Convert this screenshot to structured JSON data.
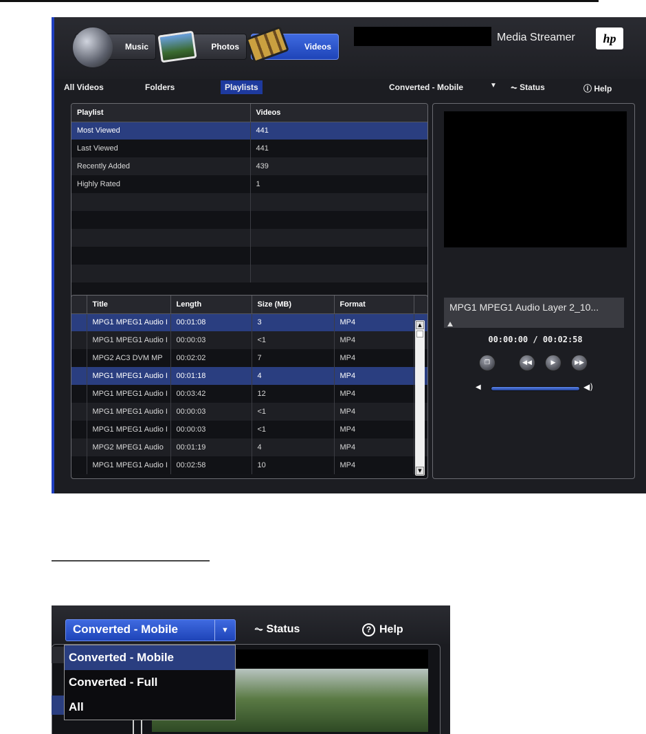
{
  "app": {
    "tabs": [
      {
        "label": "Music",
        "active": false
      },
      {
        "label": "Photos",
        "active": false
      },
      {
        "label": "Videos",
        "active": true
      }
    ],
    "brand": "Media Streamer",
    "logo": "hp"
  },
  "nav": {
    "items": [
      "All Videos",
      "Folders",
      "Playlists"
    ],
    "active": "Playlists",
    "filter": "Converted - Mobile",
    "status": "Status",
    "help": "Help"
  },
  "playlists": {
    "headers": [
      "Playlist",
      "Videos"
    ],
    "rows": [
      {
        "name": "Most Viewed",
        "videos": "441",
        "selected": true
      },
      {
        "name": "Last Viewed",
        "videos": "441"
      },
      {
        "name": "Recently Added",
        "videos": "439"
      },
      {
        "name": "Highly Rated",
        "videos": "1"
      }
    ]
  },
  "videos": {
    "headers": [
      "Title",
      "Length",
      "Size (MB)",
      "Format"
    ],
    "rows": [
      {
        "title": "MPG1 MPEG1 Audio I",
        "length": "00:01:08",
        "size": "3",
        "format": "MP4",
        "selected": true
      },
      {
        "title": "MPG1 MPEG1 Audio I",
        "length": "00:00:03",
        "size": "<1",
        "format": "MP4"
      },
      {
        "title": "MPG2 AC3 DVM MP",
        "length": "00:02:02",
        "size": "7",
        "format": "MP4"
      },
      {
        "title": "MPG1 MPEG1 Audio I",
        "length": "00:01:18",
        "size": "4",
        "format": "MP4",
        "selected": true
      },
      {
        "title": "MPG1 MPEG1 Audio I",
        "length": "00:03:42",
        "size": "12",
        "format": "MP4"
      },
      {
        "title": "MPG1 MPEG1 Audio I",
        "length": "00:00:03",
        "size": "<1",
        "format": "MP4"
      },
      {
        "title": "MPG1 MPEG1 Audio I",
        "length": "00:00:03",
        "size": "<1",
        "format": "MP4"
      },
      {
        "title": "MPG2 MPEG1 Audio",
        "length": "00:01:19",
        "size": "4",
        "format": "MP4"
      },
      {
        "title": "MPG1 MPEG1 Audio I",
        "length": "00:02:58",
        "size": "10",
        "format": "MP4"
      }
    ]
  },
  "player": {
    "now_playing": "MPG1 MPEG1 Audio Layer 2_10...",
    "time": "00:00:00  /  00:02:58",
    "volume": 0.5
  },
  "zoom": {
    "dropdown_value": "Converted - Mobile",
    "status": "Status",
    "help": "Help",
    "options": [
      "Converted - Mobile",
      "Converted - Full",
      "All"
    ],
    "selected_option": "Converted - Mobile"
  },
  "colors": {
    "accent": "#1e44b8",
    "selection": "#2a3e80",
    "panel": "#121317",
    "frame": "#1f3fbf"
  }
}
